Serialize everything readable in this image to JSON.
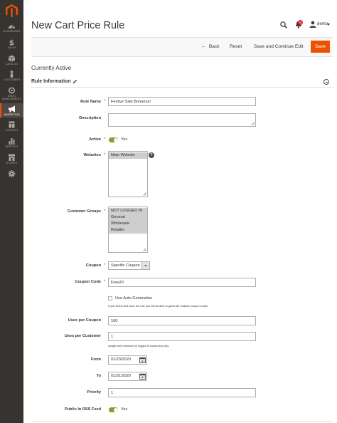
{
  "sidebar": {
    "items": [
      {
        "label": "DASHBOARD",
        "icon": "dashboard-icon"
      },
      {
        "label": "SALES",
        "icon": "dollar-icon"
      },
      {
        "label": "CATALOG",
        "icon": "cube-icon"
      },
      {
        "label": "CUSTOMERS",
        "icon": "person-icon"
      },
      {
        "label_1": "DEMO",
        "label_2": "MANAGEMENT",
        "icon": "demo-management-icon"
      },
      {
        "label": "MARKETING",
        "icon": "megaphone-icon"
      },
      {
        "label": "CONTENT",
        "icon": "layout-icon"
      },
      {
        "label": "REPORTS",
        "icon": "bar-chart-icon"
      },
      {
        "label": "STORES",
        "icon": "store-icon"
      },
      {
        "label": "",
        "icon": "gear-icon"
      }
    ],
    "colors": {
      "background": "#373330",
      "active_accent": "#eb5202"
    }
  },
  "header": {
    "title": "New Cart Price Rule",
    "notification_count": "8",
    "user_name": "demo"
  },
  "actions": {
    "back": "Back",
    "reset": "Reset",
    "save_continue": "Save and Continue Edit",
    "save": "Save",
    "save_color": "#eb5202"
  },
  "status": "Currently Active",
  "section": {
    "title": "Rule Information"
  },
  "form": {
    "rule_name": {
      "label": "Rule Name",
      "value": "Festive Sale Bonanza!"
    },
    "description": {
      "label": "Description",
      "value": ""
    },
    "active": {
      "label": "Active",
      "state": "Yes"
    },
    "websites": {
      "label": "Websites",
      "options": [
        "Main Website"
      ]
    },
    "customer_groups": {
      "label": "Customer Groups",
      "options": [
        "NOT LOGGED IN",
        "General",
        "Wholesale",
        "Retailer"
      ]
    },
    "coupon": {
      "label": "Coupon",
      "value": "Specific Coupon"
    },
    "coupon_code": {
      "label": "Coupon Code",
      "value": "Free20"
    },
    "auto_generation": {
      "label": "Use Auto Generation",
      "note": "If you select and save the rule you will be able to generate multiple coupon codes."
    },
    "uses_per_coupon": {
      "label": "Uses per Coupon",
      "value": "100"
    },
    "uses_per_customer": {
      "label": "Uses per Customer",
      "value": "1",
      "note": "Usage limit enforced for logged in customers only."
    },
    "from": {
      "label": "From",
      "value": "01/23/2020"
    },
    "to": {
      "label": "To",
      "value": "01/31/2020"
    },
    "priority": {
      "label": "Priority",
      "value": "1"
    },
    "rss": {
      "label": "Public In RSS Feed",
      "state": "Yes"
    }
  }
}
